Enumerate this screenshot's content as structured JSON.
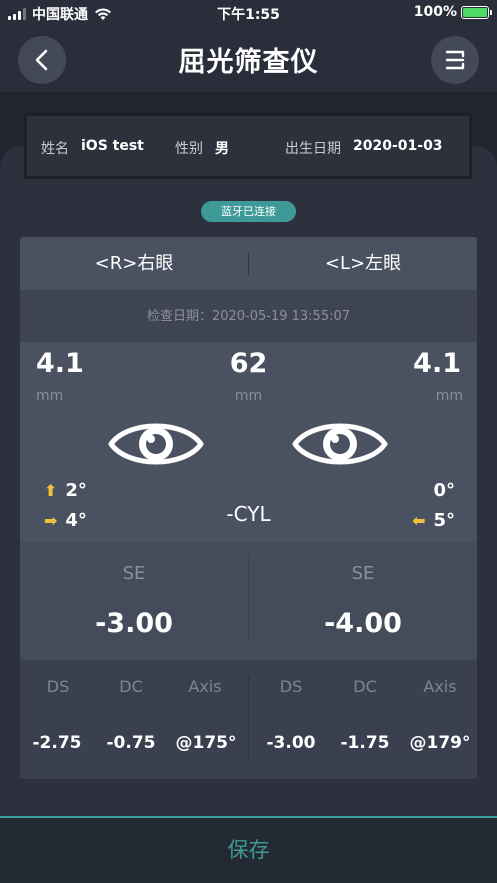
{
  "status_bar": {
    "carrier": "中国联通",
    "time": "下午1:55",
    "battery": "100%"
  },
  "nav": {
    "title": "屈光筛查仪",
    "back_icon": "chevron-left-icon",
    "menu_icon": "menu-icon"
  },
  "user": {
    "name_label": "姓名",
    "name": "iOS test",
    "gender_label": "性别",
    "gender": "男",
    "birth_label": "出生日期",
    "birth": "2020-01-03"
  },
  "bluetooth_status": "蓝牙已连接",
  "tabs": {
    "right_eye": "<R>右眼",
    "left_eye": "<L>左眼"
  },
  "exam_date": "检查日期：2020-05-19 13:55:07",
  "measurements": {
    "right_pupil": "4.1",
    "pd": "62",
    "left_pupil": "4.1",
    "unit": "mm",
    "right_vertical": "2°",
    "right_horizontal": "4°",
    "left_vertical": "0°",
    "left_horizontal": "5°",
    "cyl_label": "-CYL"
  },
  "se": {
    "label": "SE",
    "right": "-3.00",
    "left": "-4.00"
  },
  "details": {
    "headers": [
      "DS",
      "DC",
      "Axis"
    ],
    "right": [
      "-2.75",
      "-0.75",
      "@175°"
    ],
    "left": [
      "-3.00",
      "-1.75",
      "@179°"
    ]
  },
  "save_label": "保存",
  "colors": {
    "accent": "#3e9896",
    "arrow": "#f3bf3b",
    "battery": "#4cd964"
  }
}
